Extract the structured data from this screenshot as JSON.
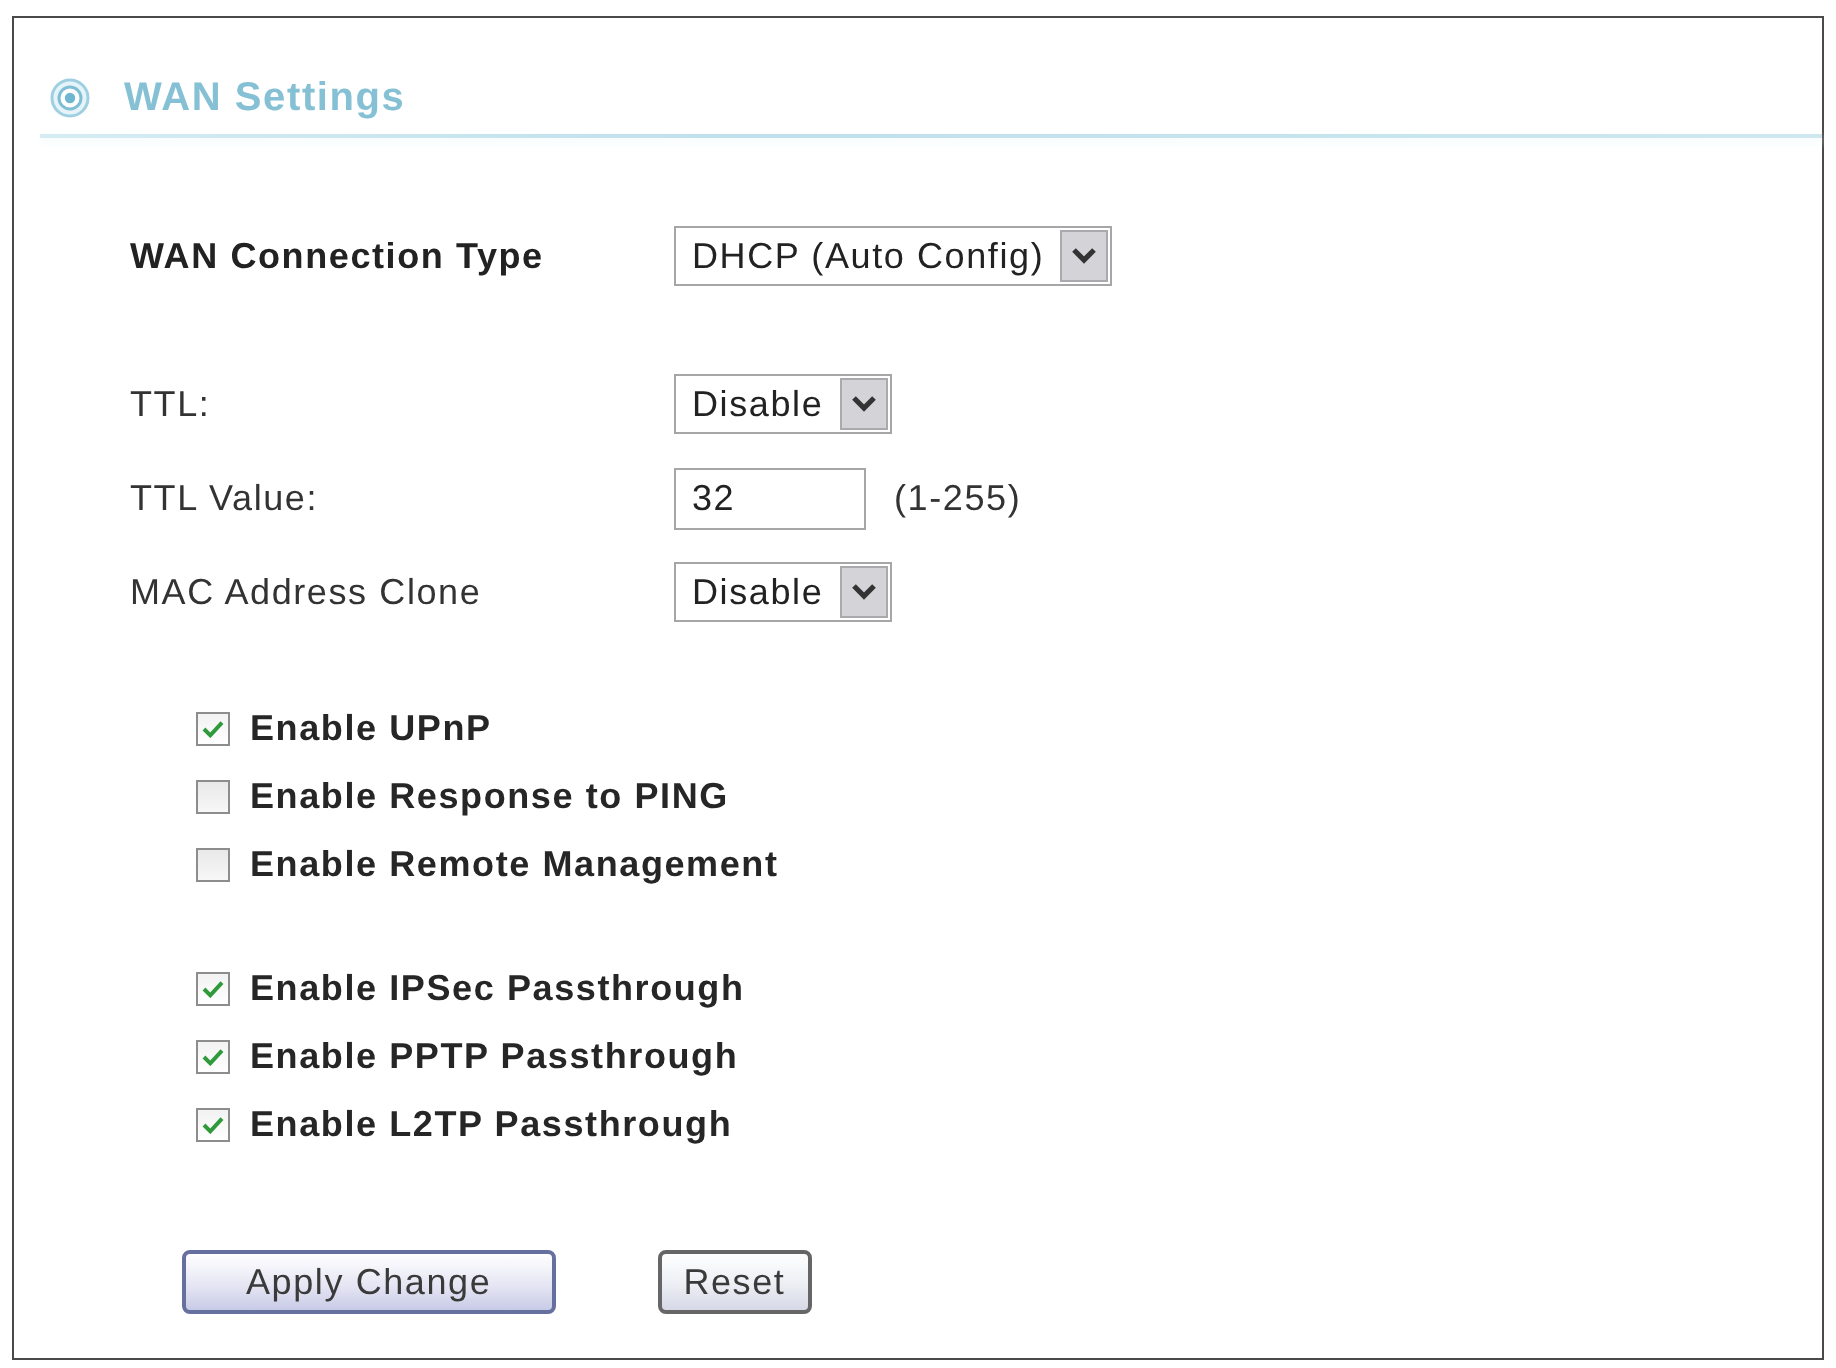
{
  "panel": {
    "title": "WAN Settings"
  },
  "sections": [
    {
      "fields": [
        {
          "kind": "select",
          "label": "WAN Connection Type",
          "bold": true,
          "value": "DHCP (Auto Config)"
        }
      ]
    },
    {
      "fields": [
        {
          "kind": "select",
          "label": "TTL:",
          "bold": false,
          "value": "Disable"
        },
        {
          "kind": "text",
          "label": "TTL Value:",
          "bold": false,
          "value": "32",
          "range_note": "(1-255)"
        },
        {
          "kind": "select",
          "label": "MAC Address Clone",
          "bold": false,
          "value": "Disable"
        }
      ]
    }
  ],
  "checkbox_groups": [
    [
      {
        "label": "Enable UPnP",
        "checked": true
      },
      {
        "label": "Enable Response to PING",
        "checked": false
      },
      {
        "label": "Enable Remote Management",
        "checked": false
      }
    ],
    [
      {
        "label": "Enable IPSec Passthrough",
        "checked": true
      },
      {
        "label": "Enable PPTP Passthrough",
        "checked": true
      },
      {
        "label": "Enable L2TP Passthrough",
        "checked": true
      }
    ]
  ],
  "buttons": [
    {
      "label": "Apply Change",
      "kind": "primary"
    },
    {
      "label": "Reset",
      "kind": "secondary"
    }
  ]
}
